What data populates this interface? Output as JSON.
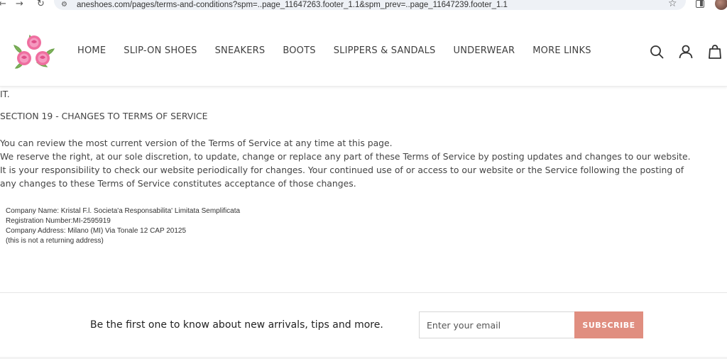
{
  "browser": {
    "url": "aneshoes.com/pages/terms-and-conditions?spm=..page_11647263.footer_1.1&spm_prev=..page_11647239.footer_1.1",
    "back_glyph": "←",
    "forward_glyph": "→",
    "reload_glyph": "↻",
    "site_info_glyph": "⚙",
    "star_glyph": "☆"
  },
  "header": {
    "nav": [
      {
        "label": "HOME"
      },
      {
        "label": "SLIP-ON SHOES"
      },
      {
        "label": "SNEAKERS"
      },
      {
        "label": "BOOTS"
      },
      {
        "label": "SLIPPERS & SANDALS"
      },
      {
        "label": "UNDERWEAR"
      },
      {
        "label": "MORE LINKS"
      }
    ],
    "icons": [
      "search-icon",
      "account-icon",
      "cart-icon"
    ]
  },
  "content": {
    "fragment": "IT.",
    "section_heading": "SECTION 19 - CHANGES TO TERMS OF SERVICE",
    "paragraph_lines": [
      "You can review the most current version of the Terms of Service at any time at this page.",
      "We reserve the right, at our sole discretion, to update, change or replace any part of these Terms of Service by posting updates and changes to our website.",
      "It is your responsibility to check our website periodically for changes. Your continued use of or access to our website or the Service following the posting of",
      "any changes to these Terms of Service constitutes acceptance of those changes."
    ],
    "company_lines": [
      "Company Name: Kristal F.l. Societa'a Responsabilita' Limitata Semplificata",
      "Registration Number:MI-2595919",
      "Company Address: Milano (MI) Via Tonale 12 CAP 20125",
      "(this is not a returning address)"
    ]
  },
  "newsletter": {
    "title": "Be the first one to know about new arrivals, tips and more.",
    "email_placeholder": "Enter your email",
    "subscribe_label": "SUBSCRIBE"
  },
  "colors": {
    "accent": "#e08e80",
    "text": "#444444"
  }
}
